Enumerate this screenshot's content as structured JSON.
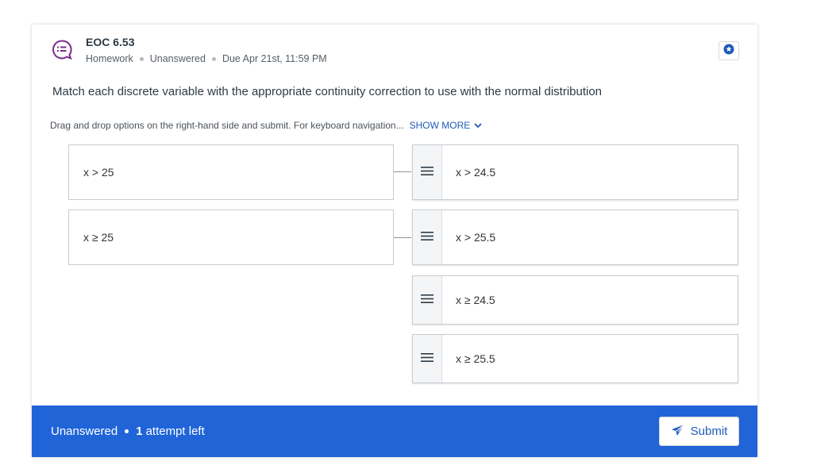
{
  "question": {
    "title": "EOC 6.53",
    "type": "Homework",
    "status": "Unanswered",
    "due": "Due Apr 21st, 11:59 PM",
    "prompt": "Match each discrete variable with the appropriate continuity correction to use with the normal distribution",
    "instructions": "Drag and drop options on the right-hand side and submit. For keyboard navigation...",
    "show_more_label": "SHOW MORE"
  },
  "premises": [
    {
      "label": "x > 25"
    },
    {
      "label": "x ≥ 25"
    }
  ],
  "options": [
    {
      "label": "x > 24.5"
    },
    {
      "label": "x > 25.5"
    },
    {
      "label": "x ≥ 24.5"
    },
    {
      "label": "x ≥ 25.5"
    }
  ],
  "footer": {
    "status": "Unanswered",
    "attempts_count": "1",
    "attempts_text": "attempt left",
    "submit_label": "Submit"
  },
  "colors": {
    "accent": "#2064d8",
    "link": "#1e5bb8",
    "question_icon": "#7b2a8e"
  },
  "icons": {
    "question": "question-bubble-icon",
    "bookmark": "star-badge-icon",
    "chevron": "chevron-down-icon",
    "handle": "drag-handle-icon",
    "submit": "paper-plane-icon"
  }
}
